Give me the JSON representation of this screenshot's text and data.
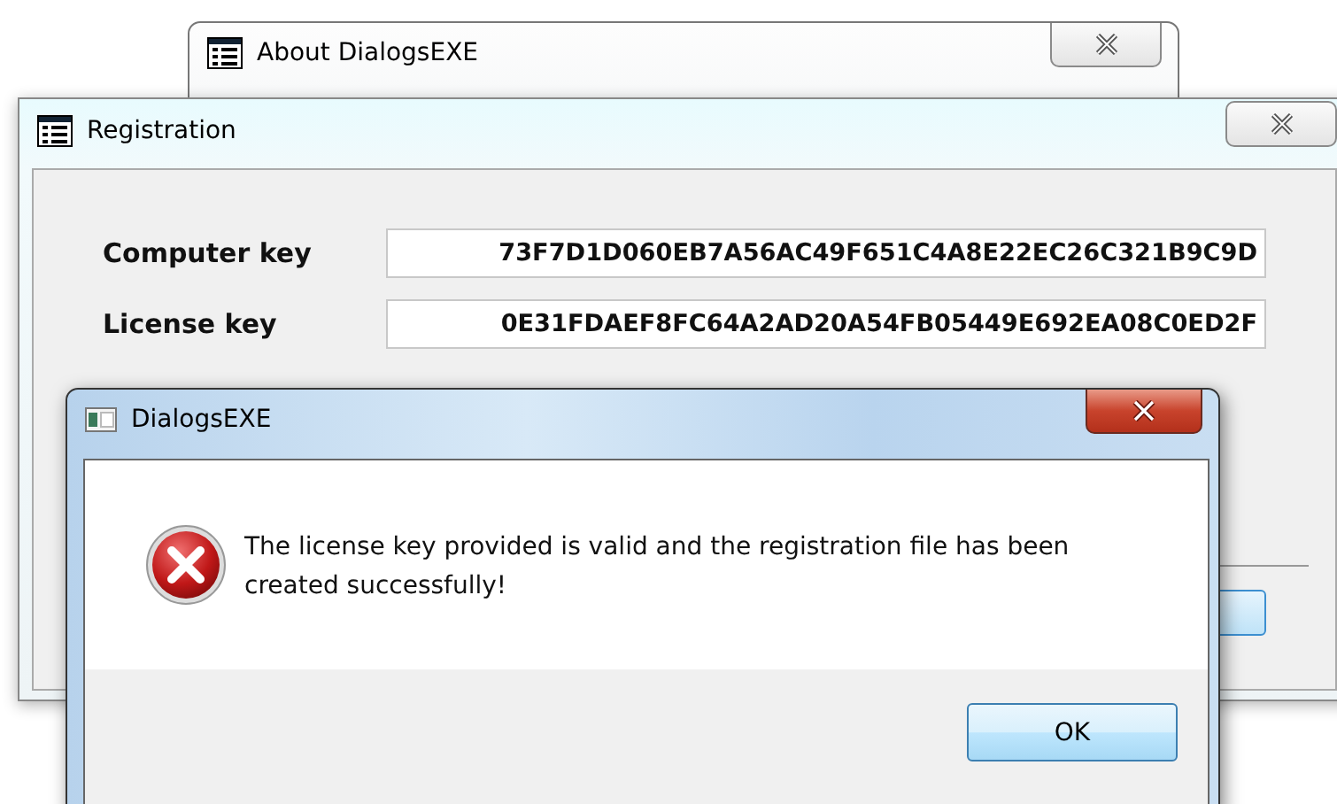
{
  "about_window": {
    "title": "About DialogsEXE"
  },
  "registration_window": {
    "title": "Registration",
    "fields": [
      {
        "label": "Computer key",
        "value": "73F7D1D060EB7A56AC49F651C4A8E22EC26C321B9C9D"
      },
      {
        "label": "License key",
        "value": "0E31FDAEF8FC64A2AD20A54FB05449E692EA08C0ED2F"
      }
    ]
  },
  "message_box": {
    "title": "DialogsEXE",
    "kind": "error",
    "text": "The license key provided is valid and the registration file has been created successfully!",
    "buttons": [
      "OK"
    ]
  }
}
